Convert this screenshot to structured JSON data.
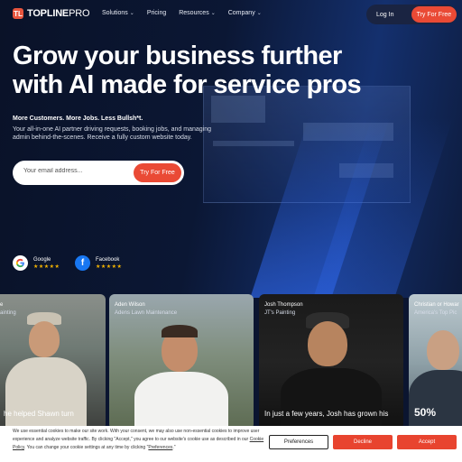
{
  "brand": {
    "logo_mark": "TL",
    "name_bold": "TOPLINE",
    "name_light": "PRO",
    "accent": "#ea4a35"
  },
  "nav": {
    "links": [
      {
        "label": "Solutions",
        "has_dropdown": true
      },
      {
        "label": "Pricing",
        "has_dropdown": false
      },
      {
        "label": "Resources",
        "has_dropdown": true
      },
      {
        "label": "Company",
        "has_dropdown": true
      }
    ],
    "login": "Log In",
    "cta": "Try For Free"
  },
  "hero": {
    "headline_line1": "Grow your business further",
    "headline_line2": "with AI made for service pros",
    "subhead": "More Customers. More Jobs. Less Bullsh*t.",
    "description": "Your all-in-one AI partner driving requests, booking jobs, and managing admin behind-the-scenes. Receive a fully custom website today.",
    "email_placeholder": "Your email address...",
    "cta": "Try For Free"
  },
  "reviews": [
    {
      "source": "Google",
      "icon": "google-icon",
      "stars": "★★★★★",
      "rating": 5
    },
    {
      "source": "Facebook",
      "icon": "facebook-icon",
      "stars": "★★★★★",
      "rating": 5
    }
  ],
  "testimonials": [
    {
      "name": "e",
      "company": "ainting",
      "quote": "he helped Shawn turn"
    },
    {
      "name": "Aden Wilson",
      "company": "Adens Lawn Maintenance",
      "quote": ""
    },
    {
      "name": "Josh Thompson",
      "company": "JT's Painting",
      "quote": "In just a few years, Josh has grown his"
    },
    {
      "name": "Christian or Howar",
      "company": "America's Top Pic",
      "quote": "50%"
    }
  ],
  "cookie": {
    "text_1": "We use essential cookies to make our site work. With your consent, we may also use non-essential cookies to improve user experience and analyze website traffic. By clicking \"Accept,\" you agree to our website's cookie use as described in our",
    "policy_link": "Cookie Policy",
    "text_2": ". You can change your cookie settings at any time by clicking \"",
    "prefs_link": "Preferences",
    "text_3": ".\"",
    "preferences": "Preferences",
    "decline": "Decline",
    "accept": "Accept"
  }
}
